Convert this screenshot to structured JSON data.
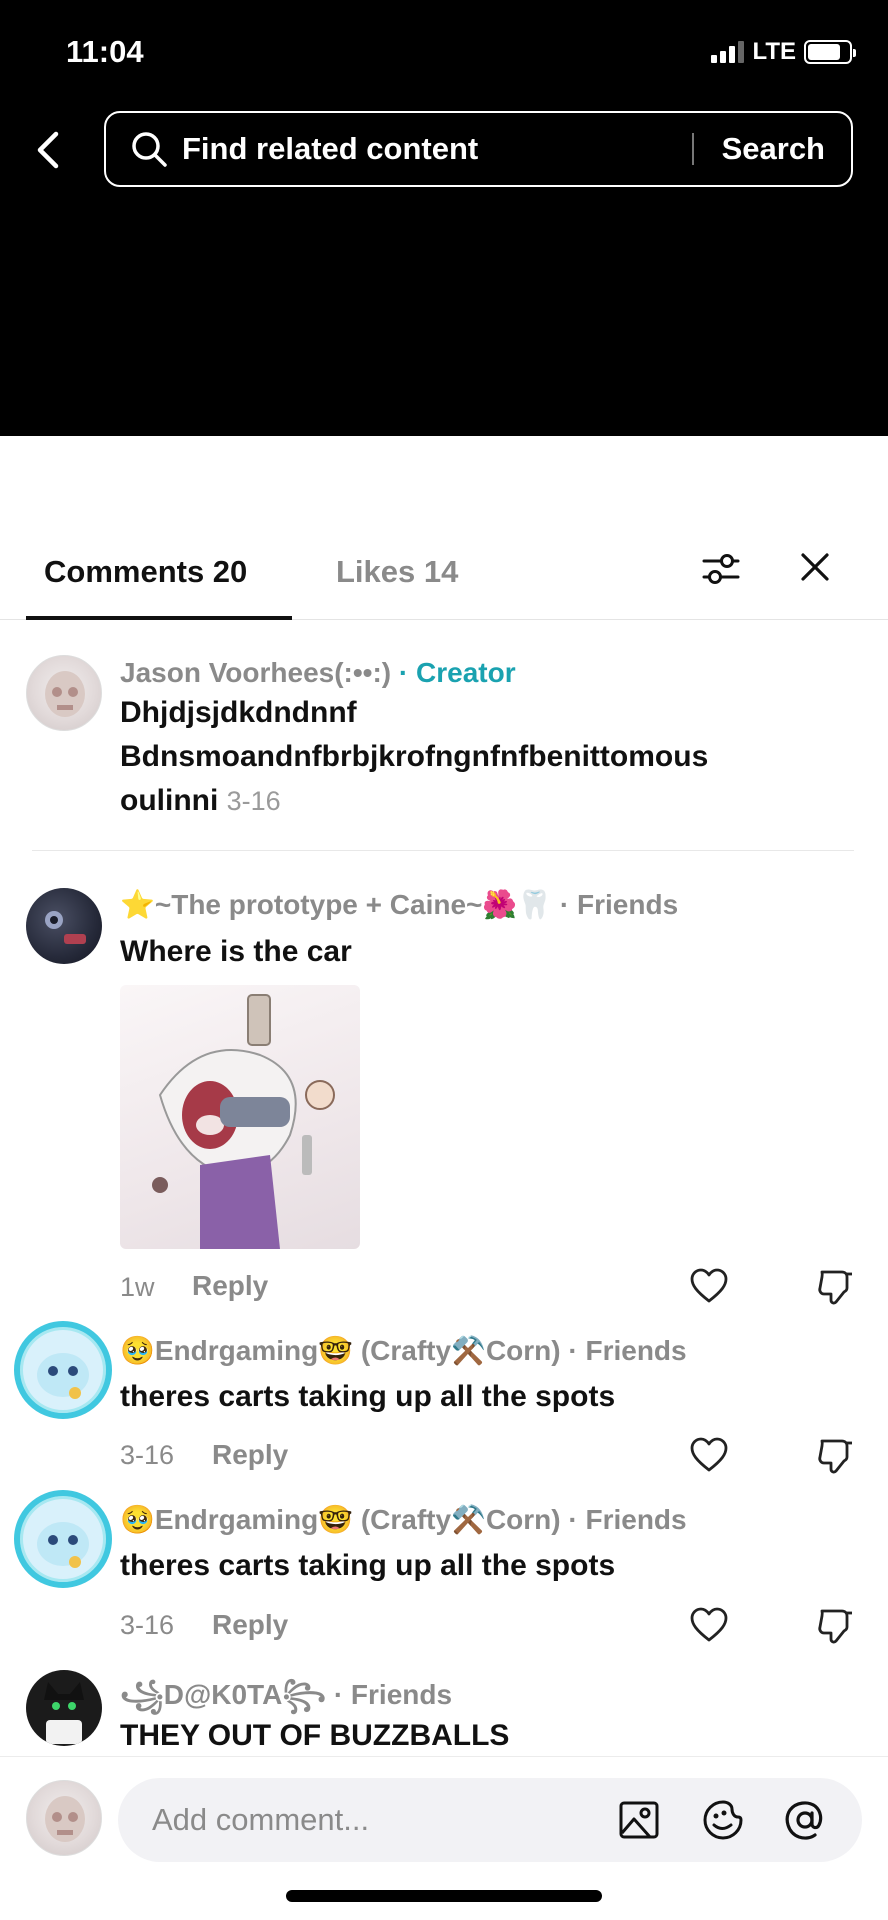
{
  "status": {
    "time": "11:04",
    "network": "LTE"
  },
  "search": {
    "placeholder": "Find related content",
    "button": "Search"
  },
  "tabs": {
    "comments": "Comments 20",
    "likes": "Likes 14"
  },
  "comments": [
    {
      "author": "Jason Voorhees(:••:)",
      "badge": "· Creator",
      "text_line1": "Dhjdjsjdkdndnnf",
      "text_line2": "Bdnsmoandnfbrbjkrofngnfnfbenittomous",
      "text_line3": "oulinni",
      "date": "3-16"
    },
    {
      "author": "⭐~The prototype + Caine~🌺🦷",
      "badge": "· Friends",
      "text": "Where is the car",
      "date": "1w",
      "reply": "Reply"
    },
    {
      "author": "🥹Endrgaming🤓 (Crafty⚒️Corn)",
      "badge": "· Friends",
      "text": "theres carts taking up all the spots",
      "date": "3-16",
      "reply": "Reply"
    },
    {
      "author": "🥹Endrgaming🤓 (Crafty⚒️Corn)",
      "badge": "· Friends",
      "text": "theres carts taking up all the spots",
      "date": "3-16",
      "reply": "Reply"
    },
    {
      "author": "꧁D@K0TA꧂",
      "badge": "· Friends",
      "text": "THEY OUT OF BUZZBALLS"
    }
  ],
  "composer": {
    "placeholder": "Add comment..."
  },
  "icons": [
    "back-icon",
    "search-icon",
    "filter-icon",
    "close-icon",
    "heart-icon",
    "dislike-icon",
    "image-icon",
    "emoji-icon",
    "mention-icon"
  ]
}
